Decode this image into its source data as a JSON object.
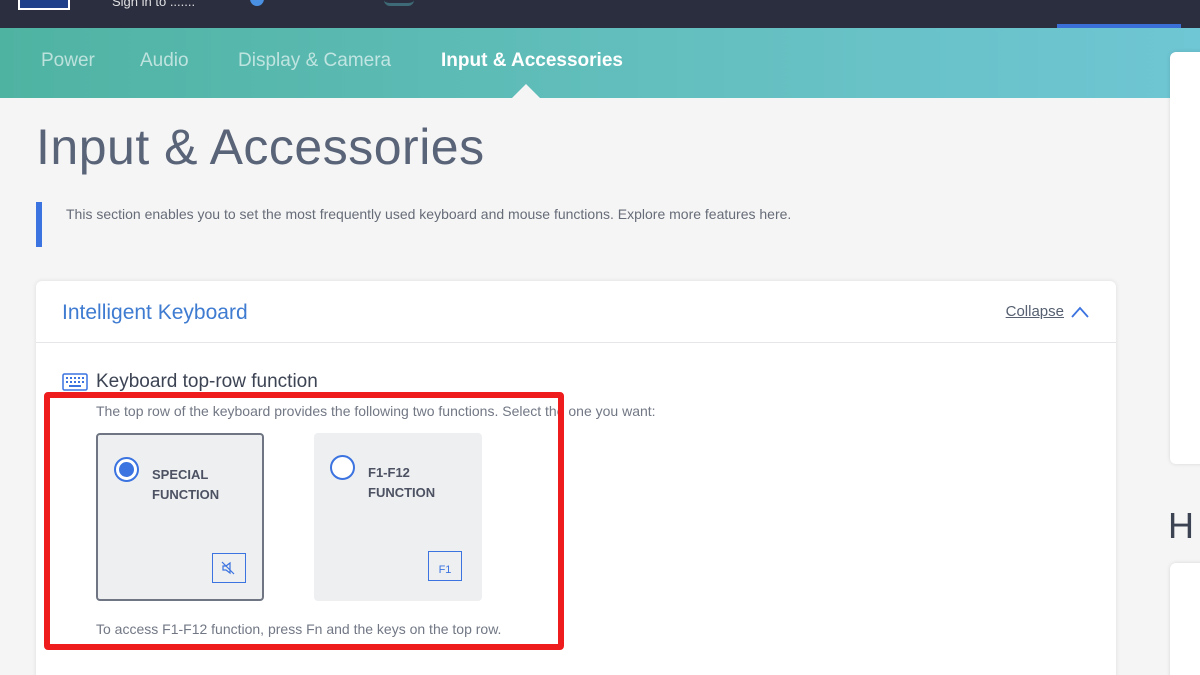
{
  "topbar": {
    "account_text": "Sign in to .......",
    "accent_color": "#3a6fd8"
  },
  "nav": {
    "tabs": [
      {
        "label": "Power",
        "active": false
      },
      {
        "label": "Audio",
        "active": false
      },
      {
        "label": "Display & Camera",
        "active": false
      },
      {
        "label": "Input & Accessories",
        "active": true
      }
    ]
  },
  "page": {
    "title": "Input & Accessories",
    "info_text": "This section enables you to set the most frequently used keyboard and mouse functions. Explore more features here."
  },
  "card": {
    "title": "Intelligent Keyboard",
    "collapse_label": "Collapse",
    "section": {
      "icon": "keyboard-icon",
      "title": "Keyboard top-row function",
      "description": "The top row of the keyboard provides the following two functions. Select the one you want:",
      "options": [
        {
          "label": "SPECIAL FUNCTION",
          "selected": true,
          "icon": "mute-key-icon"
        },
        {
          "label": "F1-F12 FUNCTION",
          "selected": false,
          "icon": "f1-key-icon",
          "key_text": "F1"
        }
      ],
      "note": "To access F1-F12 function, press Fn and the keys on the top row."
    }
  },
  "right_panel": {
    "heading_fragment": "H"
  },
  "colors": {
    "primary_blue": "#3b73e0",
    "highlight_red": "#ee1c1c",
    "teal_band": "#5dbcb6"
  }
}
